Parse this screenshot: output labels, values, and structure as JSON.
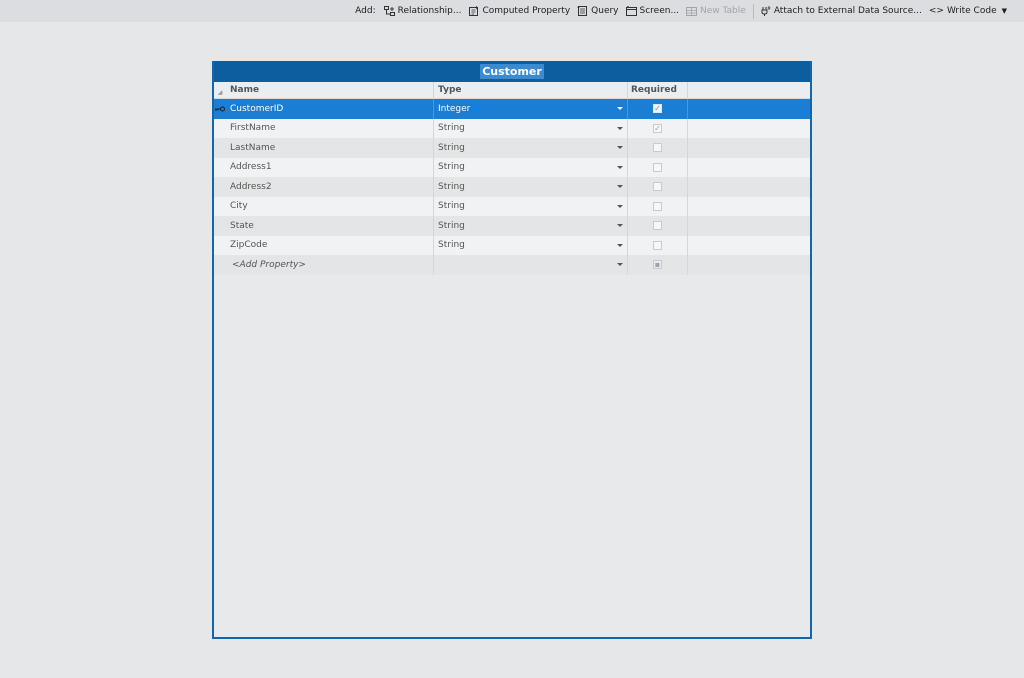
{
  "toolbar": {
    "add_label": "Add:",
    "buttons": [
      {
        "label": "Relationship...",
        "icon": "relationship-icon",
        "enabled": true
      },
      {
        "label": "Computed Property",
        "icon": "computed-property-icon",
        "enabled": true
      },
      {
        "label": "Query",
        "icon": "query-icon",
        "enabled": true
      },
      {
        "label": "Screen...",
        "icon": "screen-icon",
        "enabled": true
      },
      {
        "label": "New Table",
        "icon": "new-table-icon",
        "enabled": false
      }
    ],
    "attach_label": "Attach to External Data Source...",
    "write_code_label": "Write Code"
  },
  "entity": {
    "title": "Customer",
    "columns": {
      "name": "Name",
      "type": "Type",
      "required": "Required"
    },
    "rows": [
      {
        "name": "CustomerID",
        "type": "Integer",
        "required": true,
        "key": true,
        "selected": true
      },
      {
        "name": "FirstName",
        "type": "String",
        "required": true
      },
      {
        "name": "LastName",
        "type": "String",
        "required": false
      },
      {
        "name": "Address1",
        "type": "String",
        "required": false
      },
      {
        "name": "Address2",
        "type": "String",
        "required": false
      },
      {
        "name": "City",
        "type": "String",
        "required": false
      },
      {
        "name": "State",
        "type": "String",
        "required": false
      },
      {
        "name": "ZipCode",
        "type": "String",
        "required": false
      }
    ],
    "add_property": "<Add Property>"
  },
  "colors": {
    "title_bar": "#0d5e9e",
    "selection": "#1a7ed4",
    "border": "#1565a8"
  }
}
